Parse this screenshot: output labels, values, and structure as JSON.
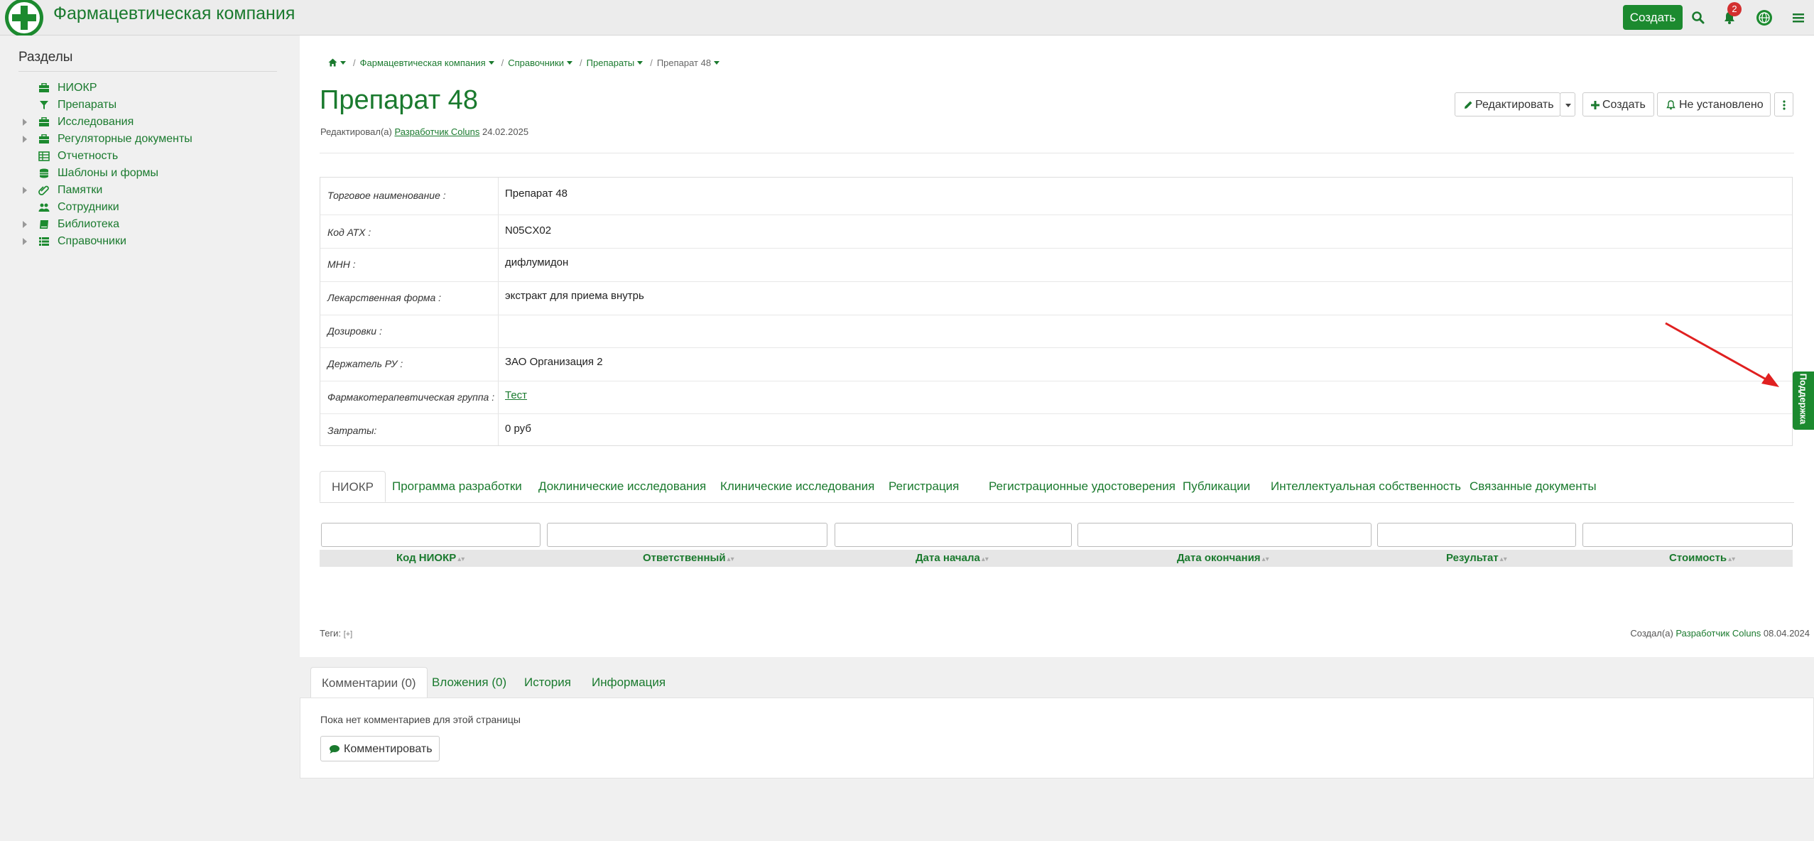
{
  "app": {
    "title": "Фармацевтическая компания"
  },
  "topbar": {
    "create_label": "Создать",
    "notifications_count": "2"
  },
  "sidebar": {
    "title": "Разделы",
    "items": [
      {
        "label": "НИОКР",
        "icon": "briefcase-icon",
        "expandable": false
      },
      {
        "label": "Препараты",
        "icon": "filter-icon",
        "expandable": false
      },
      {
        "label": "Исследования",
        "icon": "briefcase-icon",
        "expandable": true
      },
      {
        "label": "Регуляторные документы",
        "icon": "briefcase-icon",
        "expandable": true
      },
      {
        "label": "Отчетность",
        "icon": "table-icon",
        "expandable": false
      },
      {
        "label": "Шаблоны и формы",
        "icon": "database-icon",
        "expandable": false
      },
      {
        "label": "Памятки",
        "icon": "paperclip-icon",
        "expandable": true
      },
      {
        "label": "Сотрудники",
        "icon": "users-icon",
        "expandable": false
      },
      {
        "label": "Библиотека",
        "icon": "book-icon",
        "expandable": true
      },
      {
        "label": "Справочники",
        "icon": "list-icon",
        "expandable": true
      }
    ]
  },
  "breadcrumb": [
    "Фармацевтическая компания",
    "Справочники",
    "Препараты",
    "Препарат 48"
  ],
  "page": {
    "title": "Препарат 48",
    "edited_prefix": "Редактировал(а)",
    "edited_user": "Разработчик Coluns",
    "edited_date": "24.02.2025"
  },
  "toolbar": {
    "edit_label": "Редактировать",
    "create_label": "Создать",
    "notify_label": "Не установлено"
  },
  "properties": [
    {
      "label": "Торговое наименование :",
      "value": "Препарат 48"
    },
    {
      "label": "Код АТХ :",
      "value": "N05CX02"
    },
    {
      "label": "МНН :",
      "value": "дифлумидон"
    },
    {
      "label": "Лекарственная форма :",
      "value": "экстракт для приема внутрь"
    },
    {
      "label": "Дозировки :",
      "value": ""
    },
    {
      "label": "Держатель РУ :",
      "value": "ЗАО Организация 2"
    },
    {
      "label": "Фармакотерапевтическая группа :",
      "value": "Тест"
    },
    {
      "label": "Затраты:",
      "value": "0 руб"
    }
  ],
  "tabs": [
    "НИОКР",
    "Программа разработки",
    "Доклинические исследования",
    "Клинические исследования",
    "Регистрация",
    "Регистрационные удостоверения",
    "Публикации",
    "Интеллектуальная собственность",
    "Связанные документы"
  ],
  "table": {
    "columns": [
      "Код НИОКР",
      "Ответственный",
      "Дата начала",
      "Дата окончания",
      "Результат",
      "Стоимость"
    ]
  },
  "tags": {
    "label": "Теги:",
    "add": "[+]"
  },
  "created": {
    "prefix": "Создал(а)",
    "user": "Разработчик Coluns",
    "date": "08.04.2024"
  },
  "bottom_tabs": [
    "Комментарии (0)",
    "Вложения (0)",
    "История",
    "Информация"
  ],
  "comments": {
    "empty_text": "Пока нет комментариев для этой страницы",
    "button_label": "Комментировать"
  },
  "support": {
    "label": "Поддержка"
  },
  "colors": {
    "accent": "#1c8a2f",
    "link": "#1a7a2e",
    "badge": "#d32f2f",
    "annotation_arrow": "#e02020"
  }
}
